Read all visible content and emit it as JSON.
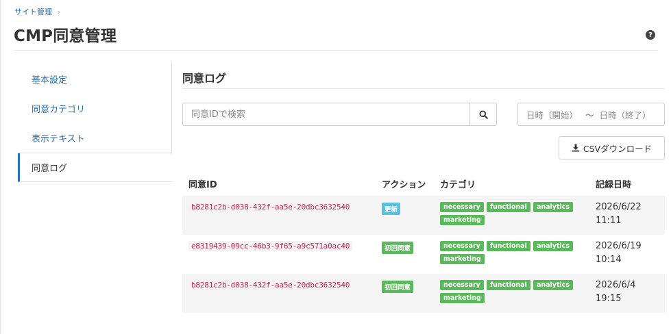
{
  "breadcrumb": {
    "items": [
      "サイト管理"
    ],
    "separator": "›"
  },
  "page": {
    "title": "CMP同意管理",
    "help_icon": "?"
  },
  "sidebar": {
    "items": [
      {
        "label": "基本設定"
      },
      {
        "label": "同意カテゴリ"
      },
      {
        "label": "表示テキスト"
      },
      {
        "label": "同意ログ",
        "active": true
      }
    ]
  },
  "content": {
    "title": "同意ログ",
    "search": {
      "placeholder": "同意IDで検索",
      "value": ""
    },
    "date_range": {
      "start_placeholder": "日時（開始）",
      "separator": "〜",
      "end_placeholder": "日時（終了）"
    },
    "csv_button": "CSVダウンロード"
  },
  "table": {
    "columns": [
      "同意ID",
      "アクション",
      "カテゴリ",
      "記録日時"
    ],
    "rows": [
      {
        "id": "b8281c2b-d038-432f-aa5e-20dbc3632540",
        "action": "更新",
        "action_type": "update",
        "categories": [
          "necessary",
          "functional",
          "analytics",
          "marketing"
        ],
        "date_line1": "2026/6/22",
        "date_line2": "11:11"
      },
      {
        "id": "e8319439-09cc-46b3-9f65-a9c571a0ac40",
        "action": "初回同意",
        "action_type": "first",
        "categories": [
          "necessary",
          "functional",
          "analytics",
          "marketing"
        ],
        "date_line1": "2026/6/19",
        "date_line2": "10:14"
      },
      {
        "id": "b8281c2b-d038-432f-aa5e-20dbc3632540",
        "action": "初回同意",
        "action_type": "first",
        "categories": [
          "necessary",
          "functional",
          "analytics",
          "marketing"
        ],
        "date_line1": "2026/6/4",
        "date_line2": "19:15"
      }
    ]
  },
  "colors": {
    "link": "#2a6fb5",
    "badge_update": "#5bc0de",
    "badge_green": "#5cb85c",
    "code_text": "#c7254e"
  }
}
